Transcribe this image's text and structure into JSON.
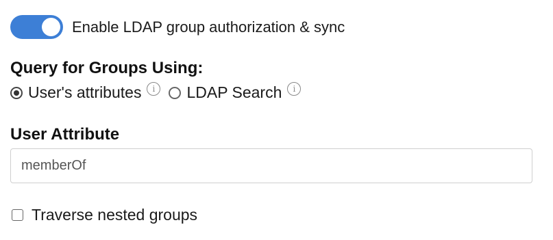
{
  "toggle": {
    "label": "Enable LDAP group authorization & sync",
    "enabled": true,
    "color": "#3d7fd6"
  },
  "query": {
    "heading": "Query for Groups Using:",
    "options": [
      {
        "label": "User's attributes",
        "selected": true,
        "icon": "info-icon"
      },
      {
        "label": "LDAP Search",
        "selected": false,
        "icon": "info-icon"
      }
    ]
  },
  "user_attribute": {
    "heading": "User Attribute",
    "value": "memberOf"
  },
  "traverse": {
    "label": "Traverse nested groups",
    "checked": false
  }
}
